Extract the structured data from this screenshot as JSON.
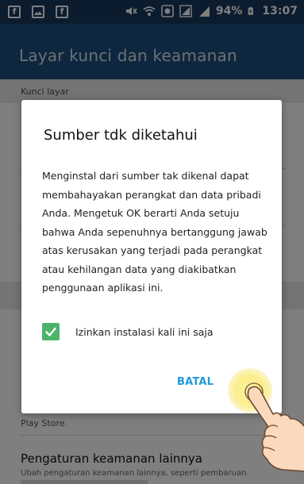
{
  "status_bar": {
    "left_icons": [
      "facebook-icon",
      "gallery-icon",
      "facebook-icon"
    ],
    "battery_percent": "94%",
    "time": "13:07"
  },
  "app_bar": {
    "title": "Layar kunci dan keamanan"
  },
  "background": {
    "section_header": "Kunci layar",
    "play_store_text": "Play Store.",
    "more_security": {
      "title": "Pengaturan keamanan lainnya",
      "subtitle": "Ubah pengaturan keamanan lainnya, seperti pembaruan"
    }
  },
  "dialog": {
    "title": "Sumber tdk diketahui",
    "body": "Menginstal dari sumber tak dikenal dapat membahayakan perangkat dan data pribadi Anda. Mengetuk OK berarti Anda setuju bahwa Anda sepenuhnya bertanggung jawab atas kerusakan yang terjadi pada perangkat atau kehilangan data yang diakibatkan penggunaan aplikasi ini.",
    "checkbox_label": "Izinkan instalasi kali ini saja",
    "checkbox_checked": true,
    "cancel_label": "BATAL"
  },
  "colors": {
    "status_bar": "#16395f",
    "app_bar": "#1f4f7d",
    "accent": "#1e9ad6",
    "checkbox": "#4cb36b"
  }
}
